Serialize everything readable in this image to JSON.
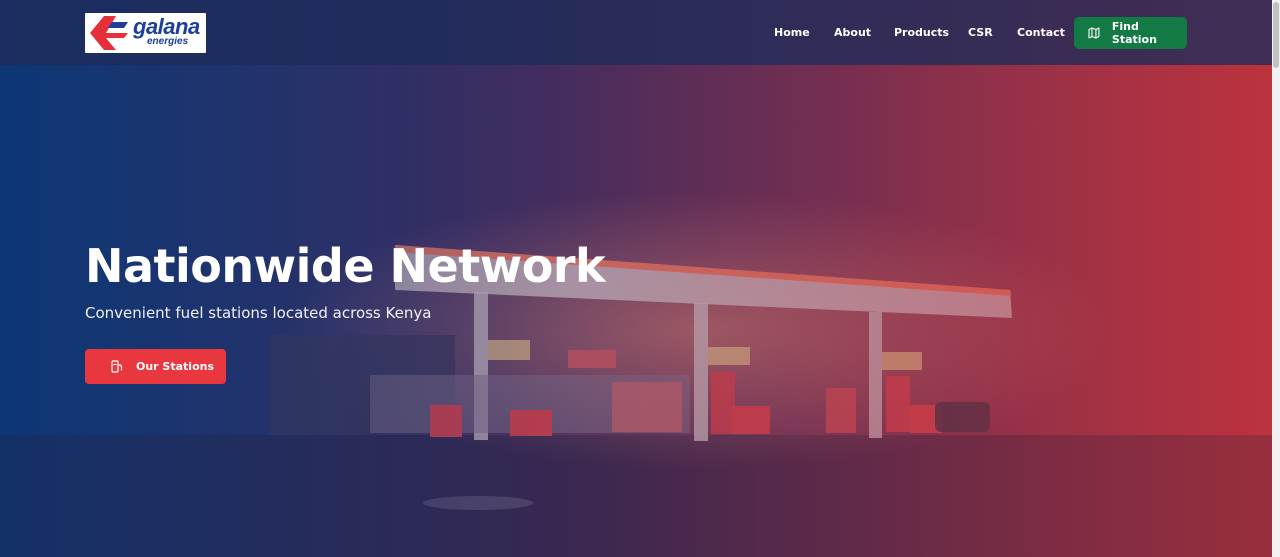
{
  "brand": {
    "name_top": "galana",
    "name_bottom": "energies",
    "colors": {
      "red": "#e5303a",
      "blue": "#1d3f9a"
    }
  },
  "nav": {
    "links": [
      {
        "label": "Home"
      },
      {
        "label": "About"
      },
      {
        "label": "Products"
      },
      {
        "label": "CSR"
      },
      {
        "label": "Contact"
      }
    ],
    "cta": {
      "label": "Find Station",
      "icon": "map-icon",
      "color": "#137a45"
    }
  },
  "hero": {
    "title": "Nationwide Network",
    "subtitle": "Convenient fuel stations located across Kenya",
    "cta": {
      "label": "Our Stations",
      "icon": "fuel-pump-icon",
      "color": "#e8373f"
    },
    "background": "night-fuel-station-photo"
  }
}
